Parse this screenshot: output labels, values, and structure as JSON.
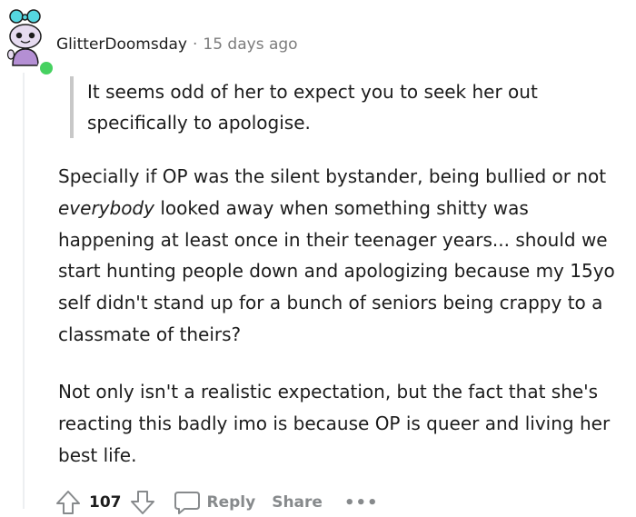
{
  "comment": {
    "author": "GlitterDoomsday",
    "separator": "·",
    "timestamp": "15 days ago",
    "quote": "It seems odd of her to expect you to seek her out specifically to apologise.",
    "paragraph1": {
      "before": "Specially if OP was the silent bystander, being bullied or not ",
      "emphasis": "everybody",
      "after": " looked away when something shitty was happening at least once in their teenager years... should we start hunting people down and apologizing because my 15yo self didn't stand up for a bunch of seniors being crappy to a classmate of theirs?"
    },
    "paragraph2": "Not only isn't a realistic expectation, but the fact that she's reacting this badly imo is because OP is queer and living her best life."
  },
  "actions": {
    "vote_count": "107",
    "reply_label": "Reply",
    "share_label": "Share",
    "more_label": "•••"
  },
  "colors": {
    "online_status": "#46d160",
    "meta_gray": "#7c7c7c",
    "quote_bar": "#c8c8c8",
    "avatar_hair": "#55d6e0"
  },
  "icons": {
    "upvote": "arrow-up-outline-icon",
    "downvote": "arrow-down-outline-icon",
    "reply": "speech-bubble-icon",
    "more": "ellipsis-icon"
  }
}
